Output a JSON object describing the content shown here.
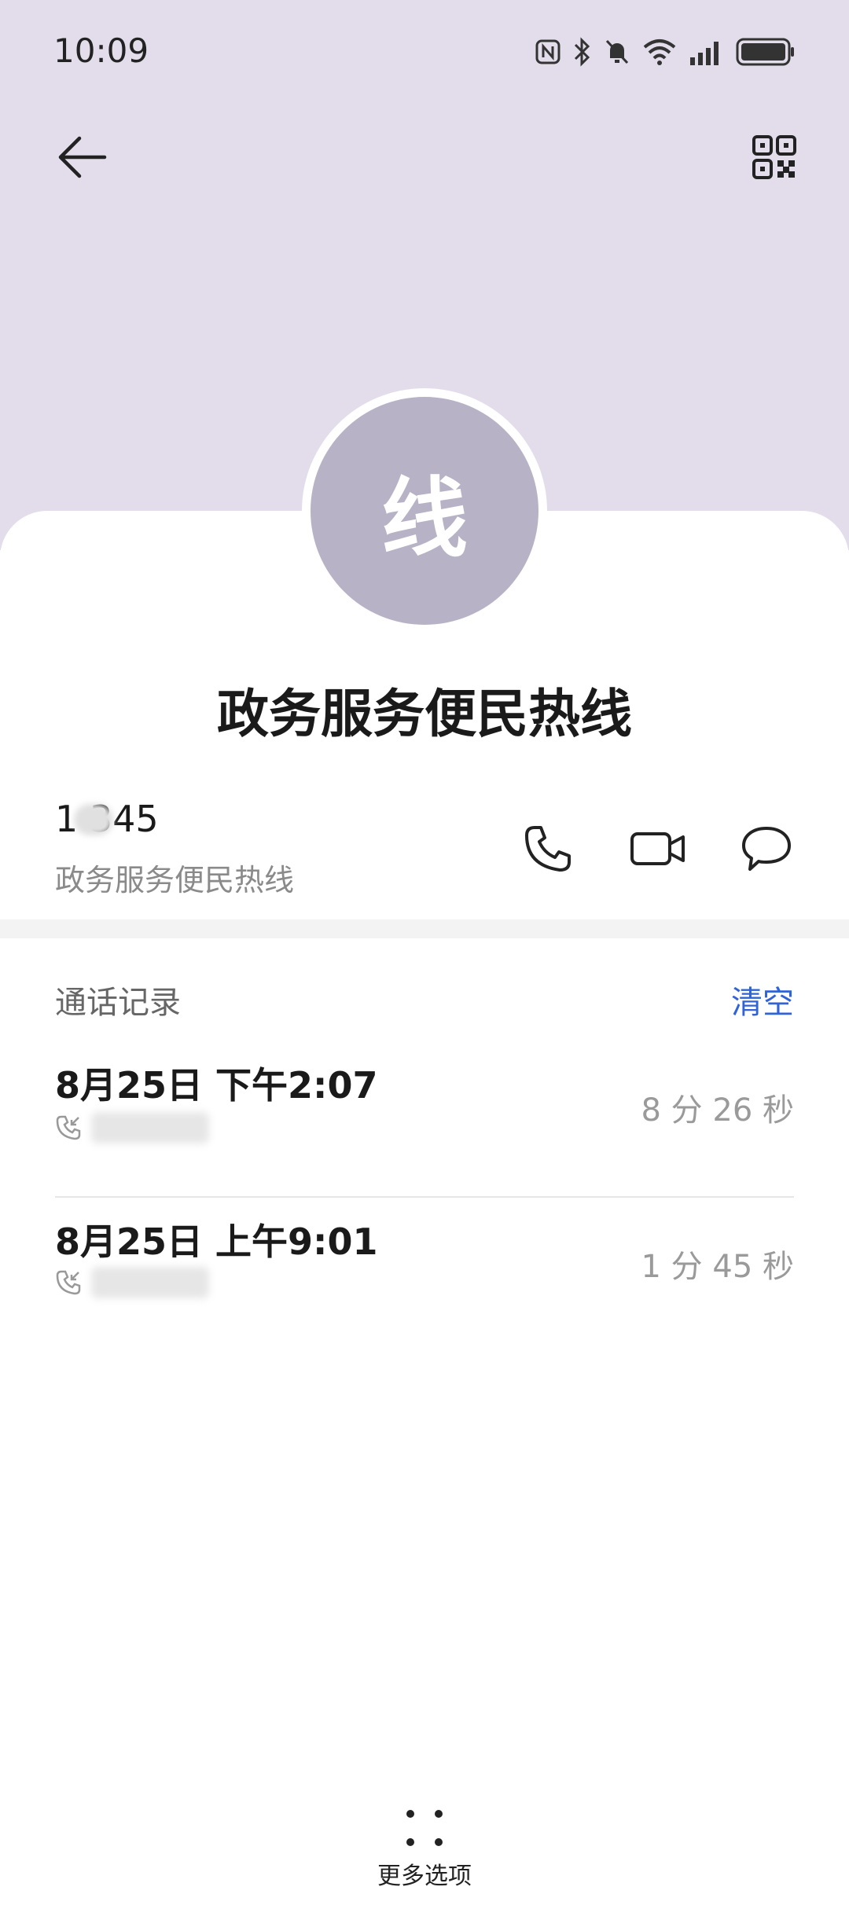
{
  "status_bar": {
    "time": "10:09",
    "icons": [
      "nfc-icon",
      "bluetooth-icon",
      "mute-icon",
      "wifi-icon",
      "signal-icon",
      "battery-icon"
    ]
  },
  "header": {
    "back_icon": "arrow-left-icon",
    "qr_icon": "qr-code-icon"
  },
  "contact": {
    "avatar_char": "线",
    "name": "政务服务便民热线",
    "number": "1 345",
    "number_label": "政务服务便民热线"
  },
  "actions": {
    "call_icon": "phone-icon",
    "video_icon": "video-icon",
    "message_icon": "message-icon"
  },
  "call_log": {
    "title": "通话记录",
    "clear_label": "清空",
    "records": [
      {
        "date": "8月25日 下午2:07",
        "duration": "8 分 26 秒"
      },
      {
        "date": "8月25日 上午9:01",
        "duration": "1 分 45 秒"
      }
    ]
  },
  "footer": {
    "more_label": "更多选项"
  },
  "colors": {
    "header_bg": "#e3dcea",
    "avatar_bg": "#b8b2c6",
    "accent": "#2f63d6"
  }
}
